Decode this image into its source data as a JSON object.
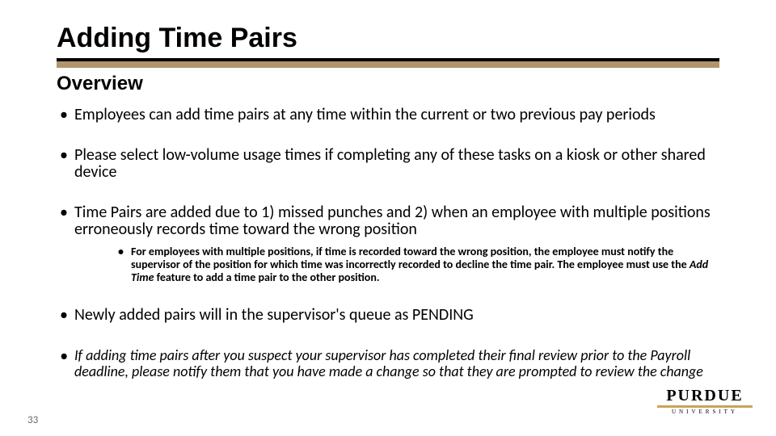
{
  "title": "Adding Time Pairs",
  "subtitle": "Overview",
  "bullets": {
    "b1": "Employees can add time pairs at any time within the current or two previous pay periods",
    "b2": "Please select low-volume usage times if completing any of these tasks on a kiosk or other shared device",
    "b3": "Time Pairs are added due to 1) missed punches and 2) when an employee with multiple positions erroneously records time toward the wrong position",
    "b3_sub_pre": "For employees with multiple positions, if time is recorded toward the wrong position, the employee must notify the supervisor of the position for which time was incorrectly recorded to decline the time pair. The employee must use the ",
    "b3_sub_em": "Add Time",
    "b3_sub_post": " feature to add a time pair to the other position.",
    "b4": "Newly added pairs will in the supervisor's queue as PENDING",
    "b5": "If adding time pairs after you suspect your supervisor has completed their final review prior to the Payroll deadline, please notify them that you have made a change so that they are prompted to review the change"
  },
  "page_number": "33",
  "logo": {
    "top": "PURDUE",
    "sub": "UNIVERSITY"
  },
  "colors": {
    "gold": "#b1946c",
    "logo_gold": "#c9a557"
  }
}
